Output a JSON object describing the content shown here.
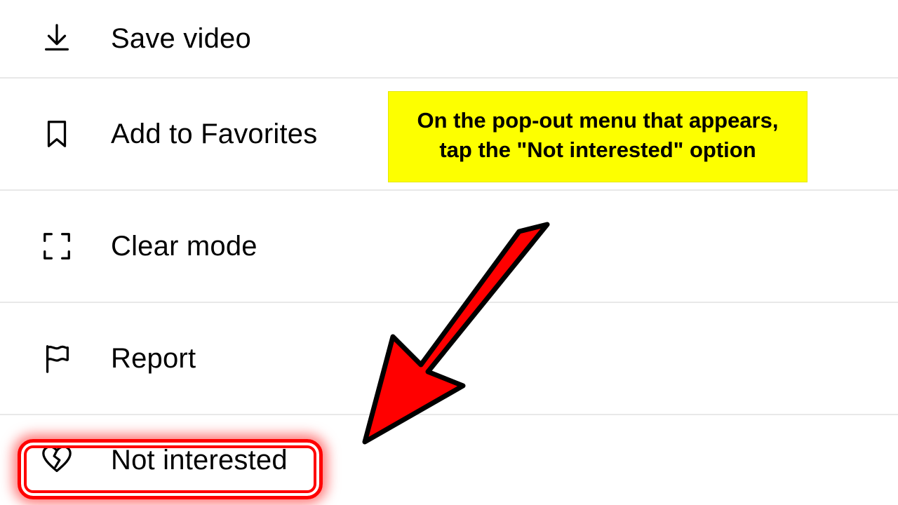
{
  "menu": {
    "items": [
      {
        "icon": "download-icon",
        "label": "Save video"
      },
      {
        "icon": "bookmark-icon",
        "label": "Add to Favorites"
      },
      {
        "icon": "fullscreen-icon",
        "label": "Clear mode"
      },
      {
        "icon": "flag-icon",
        "label": "Report"
      },
      {
        "icon": "broken-heart-icon",
        "label": "Not interested"
      }
    ]
  },
  "callout": {
    "text": "On the pop-out menu that appears, tap the \"Not interested\" option"
  },
  "colors": {
    "highlight": "#ff0000",
    "callout_bg": "#fdff00"
  }
}
